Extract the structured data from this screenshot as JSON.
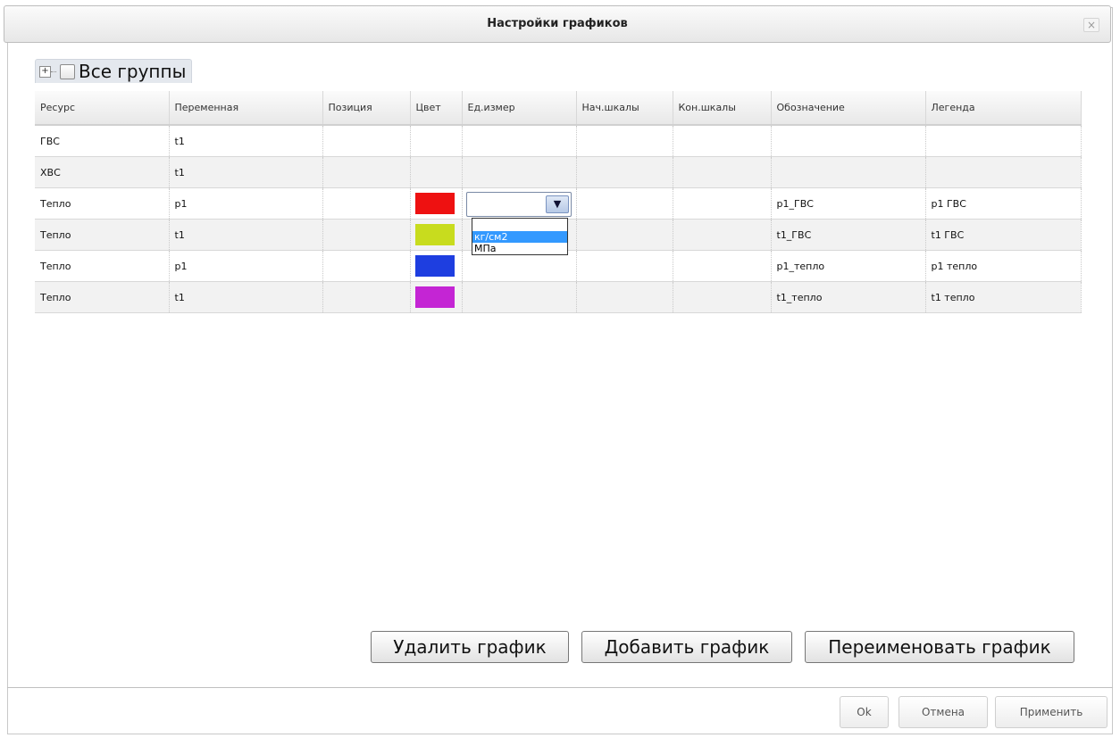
{
  "dialog": {
    "title": "Настройки графиков",
    "close_glyph": "×"
  },
  "group": {
    "label": "Все группы",
    "expander_glyph": "+"
  },
  "table": {
    "columns": [
      "Ресурс",
      "Переменная",
      "Позиция",
      "Цвет",
      "Ед.измер",
      "Нач.шкалы",
      "Кон.шкалы",
      "Обозначение",
      "Легенда"
    ],
    "rows": [
      {
        "resource": "ГВС",
        "variable": "t1",
        "position": "",
        "color": "",
        "unit": "",
        "scale_start": "",
        "scale_end": "",
        "designation": "",
        "legend": ""
      },
      {
        "resource": "ХВС",
        "variable": "t1",
        "position": "",
        "color": "",
        "unit": "",
        "scale_start": "",
        "scale_end": "",
        "designation": "",
        "legend": ""
      },
      {
        "resource": "Тепло",
        "variable": "p1",
        "position": "",
        "color": "#ee1111",
        "unit": "",
        "scale_start": "",
        "scale_end": "",
        "designation": "p1_ГВС",
        "legend": "p1 ГВС"
      },
      {
        "resource": "Тепло",
        "variable": "t1",
        "position": "",
        "color": "#c8dc1e",
        "unit": "",
        "scale_start": "",
        "scale_end": "",
        "designation": "t1_ГВС",
        "legend": "t1 ГВС"
      },
      {
        "resource": "Тепло",
        "variable": "p1",
        "position": "",
        "color": "#1e3ee0",
        "unit": "",
        "scale_start": "",
        "scale_end": "",
        "designation": "p1_тепло",
        "legend": "p1 тепло"
      },
      {
        "resource": "Тепло",
        "variable": "t1",
        "position": "",
        "color": "#c425d4",
        "unit": "",
        "scale_start": "",
        "scale_end": "",
        "designation": "t1_тепло",
        "legend": "t1 тепло"
      }
    ]
  },
  "unit_dropdown": {
    "value": "",
    "options": [
      "",
      "кг/см2",
      "МПа"
    ],
    "selected_index": 1,
    "arrow_icon": "chevron-down-icon"
  },
  "buttons": {
    "delete": "Удалить график",
    "add": "Добавить график",
    "rename": "Переименовать график",
    "ok": "Ok",
    "cancel": "Отмена",
    "apply": "Применить"
  }
}
